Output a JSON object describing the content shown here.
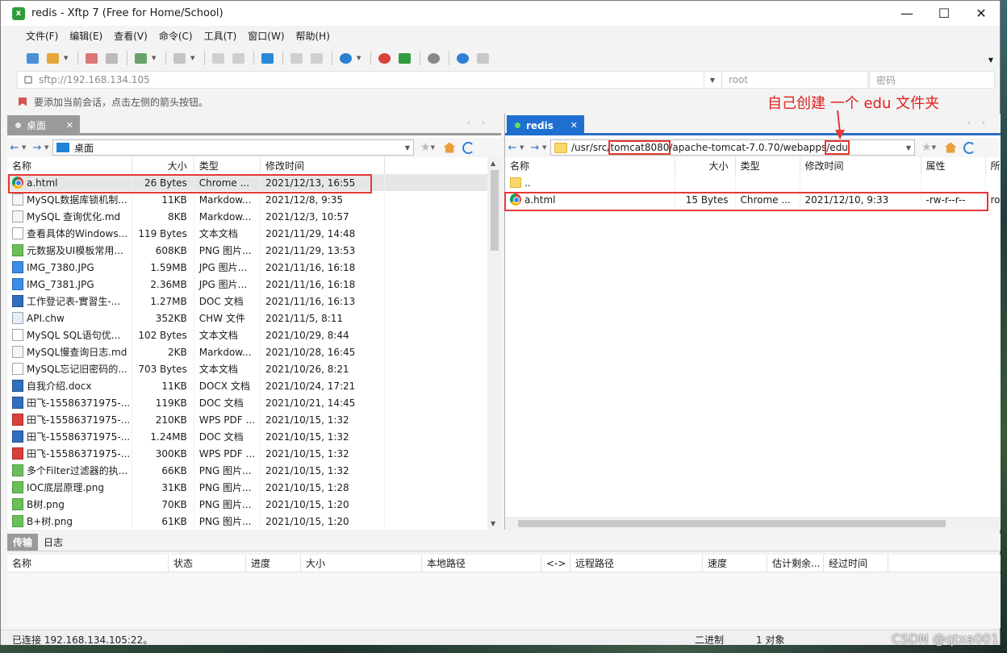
{
  "window": {
    "title": "redis - Xftp 7 (Free for Home/School)",
    "app_icon_glyph": "x"
  },
  "menu": [
    "文件(F)",
    "编辑(E)",
    "查看(V)",
    "命令(C)",
    "工具(T)",
    "窗口(W)",
    "帮助(H)"
  ],
  "address": {
    "url_placeholder": "sftp://192.168.134.105",
    "user_placeholder": "root",
    "password_placeholder": "密码"
  },
  "hint": "要添加当前会话，点击左侧的箭头按钮。",
  "annotation": "自己创建 一个 edu 文件夹",
  "left": {
    "tab": "桌面",
    "path": "桌面",
    "columns": [
      "名称",
      "大小",
      "类型",
      "修改时间"
    ],
    "rows": [
      {
        "icon": "chrome",
        "name": "a.html",
        "size": "26 Bytes",
        "type": "Chrome ...",
        "date": "2021/12/13, 16:55"
      },
      {
        "icon": "md",
        "name": "MySQL数据库锁机制...",
        "size": "11KB",
        "type": "Markdow...",
        "date": "2021/12/8, 9:35"
      },
      {
        "icon": "md",
        "name": "MySQL 查询优化.md",
        "size": "8KB",
        "type": "Markdow...",
        "date": "2021/12/3, 10:57"
      },
      {
        "icon": "txt",
        "name": "查看具体的Windows...",
        "size": "119 Bytes",
        "type": "文本文档",
        "date": "2021/11/29, 14:48"
      },
      {
        "icon": "png",
        "name": "元数据及UI模板常用...",
        "size": "608KB",
        "type": "PNG 图片...",
        "date": "2021/11/29, 13:53"
      },
      {
        "icon": "jpg",
        "name": "IMG_7380.JPG",
        "size": "1.59MB",
        "type": "JPG 图片...",
        "date": "2021/11/16, 16:18"
      },
      {
        "icon": "jpg",
        "name": "IMG_7381.JPG",
        "size": "2.36MB",
        "type": "JPG 图片...",
        "date": "2021/11/16, 16:18"
      },
      {
        "icon": "doc",
        "name": "工作登记表-實習生-...",
        "size": "1.27MB",
        "type": "DOC 文档",
        "date": "2021/11/16, 16:13"
      },
      {
        "icon": "chw",
        "name": "API.chw",
        "size": "352KB",
        "type": "CHW 文件",
        "date": "2021/11/5, 8:11"
      },
      {
        "icon": "txt",
        "name": "MySQL SQL语句优...",
        "size": "102 Bytes",
        "type": "文本文档",
        "date": "2021/10/29, 8:44"
      },
      {
        "icon": "md",
        "name": "MySQL慢查询日志.md",
        "size": "2KB",
        "type": "Markdow...",
        "date": "2021/10/28, 16:45"
      },
      {
        "icon": "txt",
        "name": "MySQL忘记旧密码的...",
        "size": "703 Bytes",
        "type": "文本文档",
        "date": "2021/10/26, 8:21"
      },
      {
        "icon": "doc",
        "name": "自我介绍.docx",
        "size": "11KB",
        "type": "DOCX 文档",
        "date": "2021/10/24, 17:21"
      },
      {
        "icon": "doc",
        "name": "田飞-15586371975-...",
        "size": "119KB",
        "type": "DOC 文档",
        "date": "2021/10/21, 14:45"
      },
      {
        "icon": "pdf",
        "name": "田飞-15586371975-...",
        "size": "210KB",
        "type": "WPS PDF ...",
        "date": "2021/10/15, 1:32"
      },
      {
        "icon": "doc",
        "name": "田飞-15586371975-...",
        "size": "1.24MB",
        "type": "DOC 文档",
        "date": "2021/10/15, 1:32"
      },
      {
        "icon": "pdf",
        "name": "田飞-15586371975-...",
        "size": "300KB",
        "type": "WPS PDF ...",
        "date": "2021/10/15, 1:32"
      },
      {
        "icon": "png",
        "name": "多个Filter过滤器的执...",
        "size": "66KB",
        "type": "PNG 图片...",
        "date": "2021/10/15, 1:32"
      },
      {
        "icon": "png",
        "name": "IOC底层原理.png",
        "size": "31KB",
        "type": "PNG 图片...",
        "date": "2021/10/15, 1:28"
      },
      {
        "icon": "png",
        "name": "B树.png",
        "size": "70KB",
        "type": "PNG 图片...",
        "date": "2021/10/15, 1:20"
      },
      {
        "icon": "png",
        "name": "B+树.png",
        "size": "61KB",
        "type": "PNG 图片...",
        "date": "2021/10/15, 1:20"
      }
    ]
  },
  "right": {
    "tab": "redis",
    "path": {
      "prefix": "/usr/src/",
      "hl1": "tomcat8080",
      "mid": "/apache-tomcat-7.0.70/webapps",
      "hl2": "/edu"
    },
    "columns": [
      "名称",
      "大小",
      "类型",
      "修改时间",
      "属性",
      "所"
    ],
    "parent": "..",
    "rows": [
      {
        "icon": "chrome",
        "name": "a.html",
        "size": "15 Bytes",
        "type": "Chrome ...",
        "date": "2021/12/10, 9:33",
        "attr": "-rw-r--r--",
        "owner": "ro"
      }
    ]
  },
  "bottom": {
    "tabs": [
      "传输",
      "日志"
    ],
    "columns": [
      "名称",
      "状态",
      "进度",
      "大小",
      "本地路径",
      "<->",
      "远程路径",
      "速度",
      "估计剩余...",
      "经过时间"
    ]
  },
  "status": {
    "connection": "已连接 192.168.134.105:22。",
    "mode": "二进制",
    "objects": "1 对象"
  },
  "watermark": "CSDN @qtxa001"
}
